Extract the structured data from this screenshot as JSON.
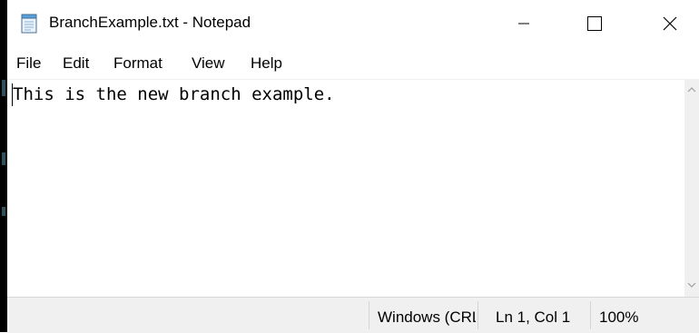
{
  "window": {
    "title": "BranchExample.txt - Notepad",
    "app_icon": "notepad-icon",
    "controls": {
      "minimize_icon": "minimize-icon",
      "maximize_icon": "maximize-icon",
      "close_icon": "close-icon"
    }
  },
  "menu": {
    "items": [
      {
        "label": "File"
      },
      {
        "label": "Edit"
      },
      {
        "label": "Format"
      },
      {
        "label": "View"
      },
      {
        "label": "Help"
      }
    ]
  },
  "editor": {
    "content": "This is the new branch example."
  },
  "status": {
    "encoding": "Windows (CRLF)",
    "position": "Ln 1, Col 1",
    "zoom": "100%"
  }
}
